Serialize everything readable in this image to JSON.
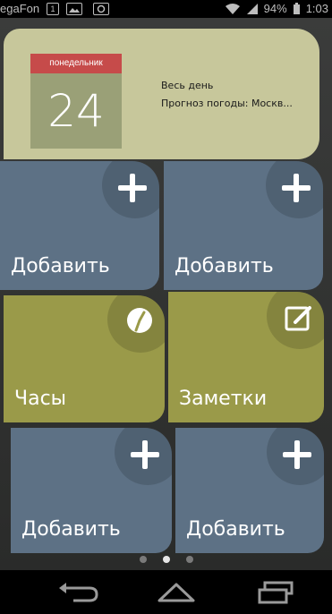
{
  "status_bar": {
    "carrier": "egaFon",
    "sim_badge": "1",
    "battery": "94%",
    "time": "1:03"
  },
  "calendar_widget": {
    "weekday": "понедельник",
    "day": "24",
    "line1": "Весь день",
    "line2": "Прогноз погоды: Москв..."
  },
  "tiles": [
    {
      "label": "Добавить",
      "icon": "plus-icon",
      "color": "#5d7185"
    },
    {
      "label": "Добавить",
      "icon": "plus-icon",
      "color": "#5d7185"
    },
    {
      "label": "Часы",
      "icon": "clock-icon",
      "color": "#9a9a49"
    },
    {
      "label": "Заметки",
      "icon": "note-edit-icon",
      "color": "#9a9a49"
    },
    {
      "label": "Добавить",
      "icon": "plus-icon",
      "color": "#5d7185"
    },
    {
      "label": "Добавить",
      "icon": "plus-icon",
      "color": "#5d7185"
    }
  ],
  "page_indicator": {
    "pages": 3,
    "current": 2
  },
  "nav": {
    "back": "back-icon",
    "home": "home-icon",
    "recents": "recents-icon"
  }
}
